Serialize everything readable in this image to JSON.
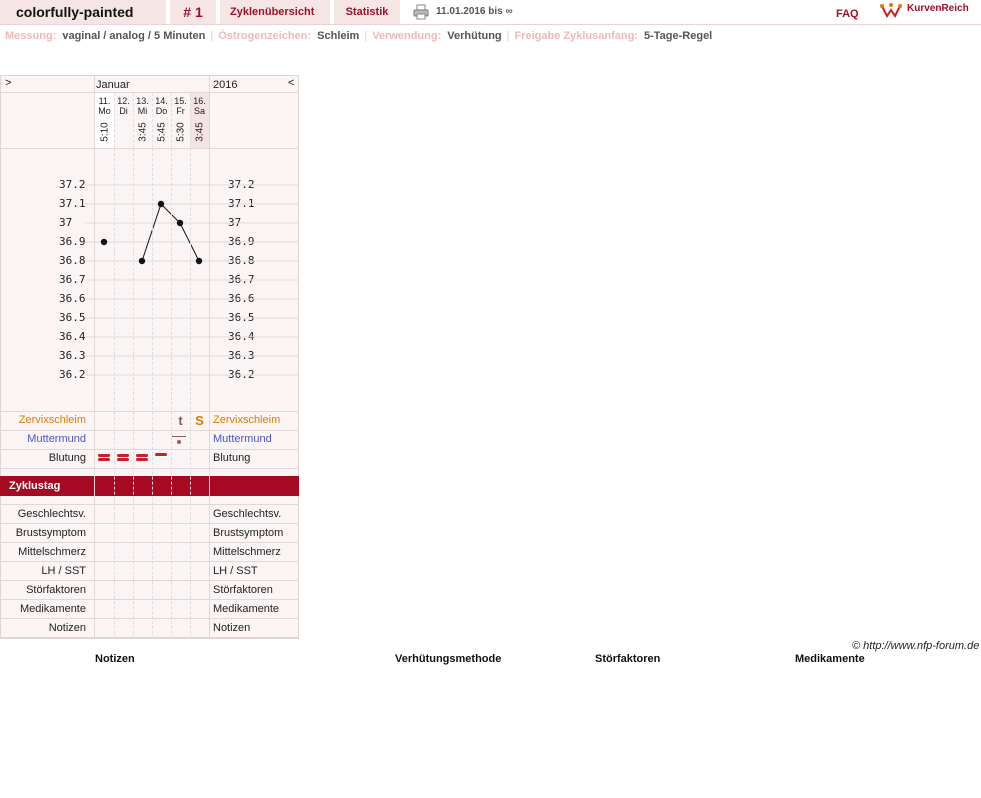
{
  "header": {
    "username": "colorfully-painted",
    "cycle_number": "# 1",
    "nav": [
      "Zyklenübersicht",
      "Statistik"
    ],
    "date_range": "11.01.2016 bis ∞",
    "faq": "FAQ",
    "logo_text": "KurvenReich",
    "colors": {
      "accent": "#a0102a",
      "tab_bg": "#f6e5e5"
    }
  },
  "info": [
    {
      "label": "Messung:",
      "value": "vaginal / analog / 5 Minuten"
    },
    {
      "label": "Östrogenzeichen:",
      "value": "Schleim"
    },
    {
      "label": "Verwendung:",
      "value": "Verhütung"
    },
    {
      "label": "Freigabe Zyklusanfang:",
      "value": "5-Tage-Regel"
    }
  ],
  "chart": {
    "prev_arrow": ">",
    "next_arrow": "<",
    "month": "Januar",
    "year": "2016",
    "days": [
      {
        "date": "11.",
        "weekday": "Mo",
        "time": "5:10",
        "temp": 36.9,
        "cycle_day": "1"
      },
      {
        "date": "12.",
        "weekday": "Di",
        "time": "",
        "temp": null,
        "cycle_day": "2"
      },
      {
        "date": "13.",
        "weekday": "Mi",
        "time": "3:45",
        "temp": 36.8,
        "cycle_day": "3"
      },
      {
        "date": "14.",
        "weekday": "Do",
        "time": "5:45",
        "temp": 37.1,
        "cycle_day": "4"
      },
      {
        "date": "15.",
        "weekday": "Fr",
        "time": "5:30",
        "temp": 37.0,
        "cycle_day": "5"
      },
      {
        "date": "16.",
        "weekday": "Sa",
        "time": "3:45",
        "temp": 36.8,
        "cycle_day": "6"
      }
    ],
    "y_ticks": [
      "37.2",
      "37.1",
      "37",
      "36.9",
      "36.8",
      "36.7",
      "36.6",
      "36.5",
      "36.4",
      "36.3",
      "36.2"
    ],
    "ylim": [
      36.2,
      37.2
    ],
    "rows": {
      "zervix": "Zervixschleim",
      "muttermund": "Muttermund",
      "blutung": "Blutung",
      "zyklustag": "Zyklustag",
      "extra": [
        "Geschlechtsv.",
        "Brustsymptom",
        "Mittelschmerz",
        "LH / SST",
        "Störfaktoren",
        "Medikamente",
        "Notizen"
      ]
    },
    "zervix_marks": [
      "",
      "",
      "",
      "",
      "t",
      "S"
    ],
    "bleeding_levels": [
      3,
      3,
      3,
      2,
      0,
      0
    ],
    "colors": {
      "zervix": "#e07b00",
      "muttermund": "#4a56c8",
      "blood": "#c8202a",
      "zyklustag_bg": "#a50a22"
    }
  },
  "footer": {
    "copyright": "© http://www.nfp-forum.de",
    "legend_headers": [
      "Notizen",
      "Verhütungsmethode",
      "Störfaktoren",
      "Medikamente"
    ]
  }
}
